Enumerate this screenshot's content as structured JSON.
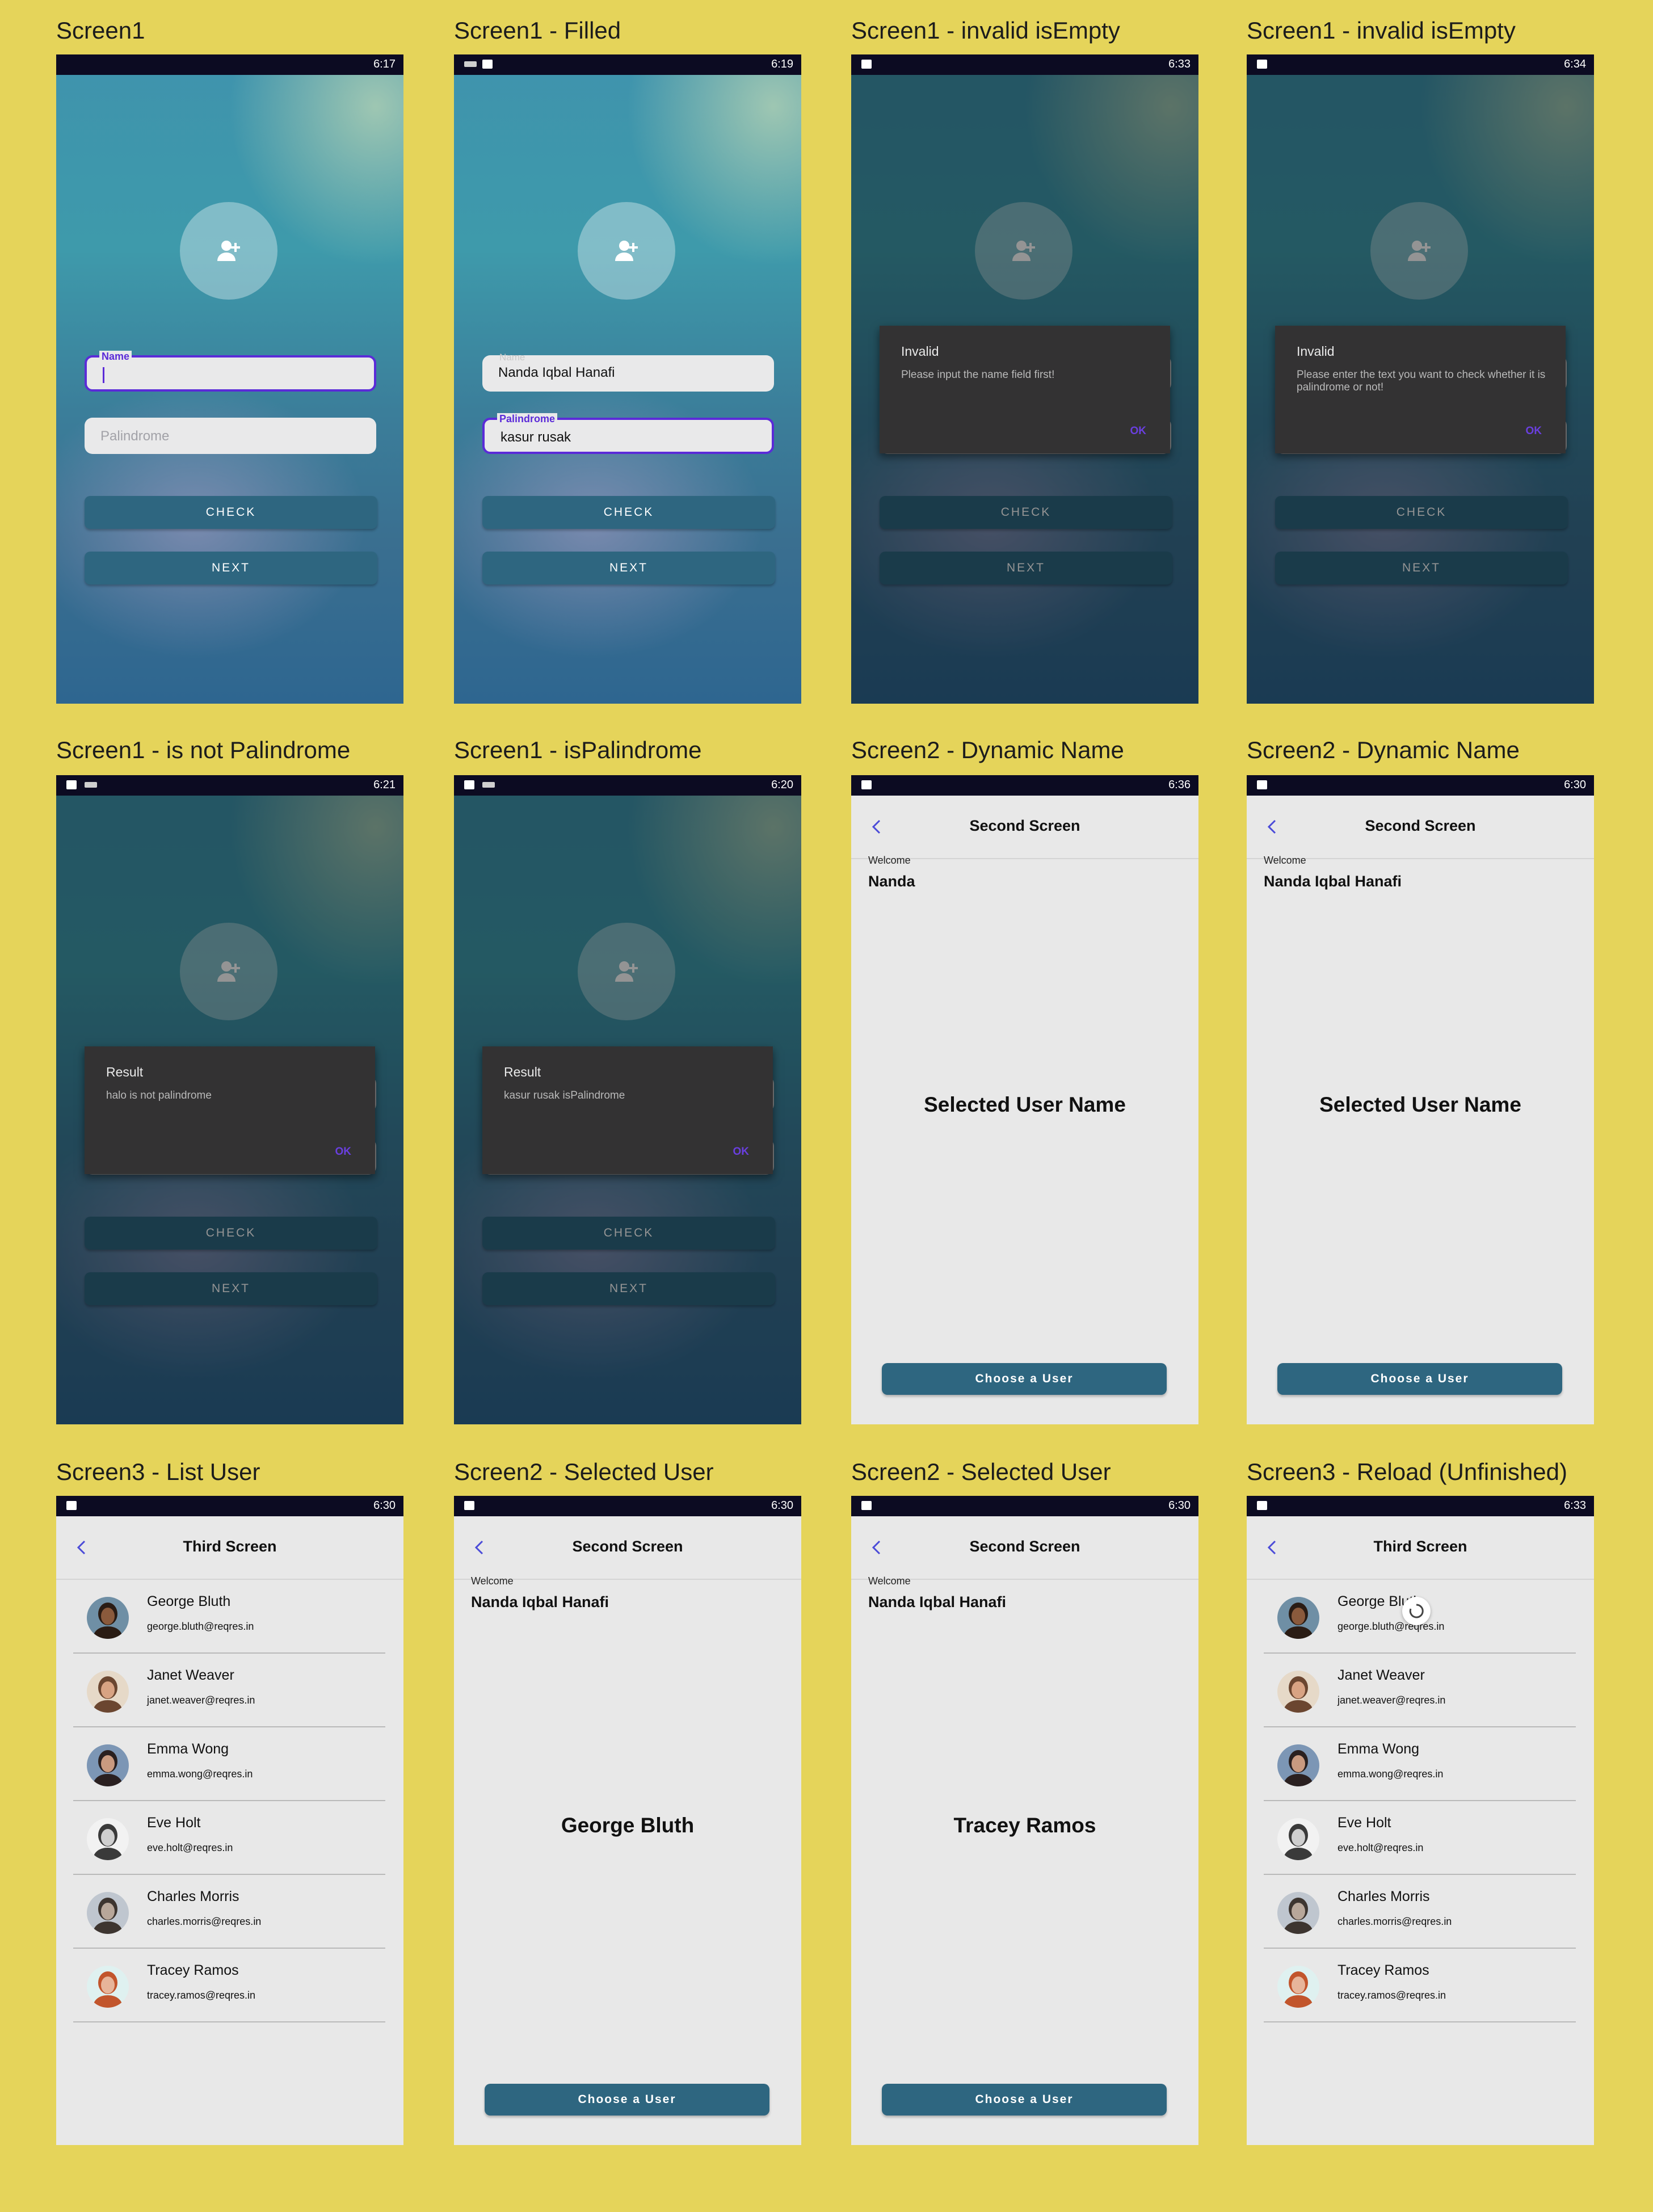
{
  "frames": [
    {
      "title": "Screen1",
      "type": "s1",
      "time": "6:17",
      "icons": [],
      "dim": false,
      "name_label": "Name",
      "name_value": "",
      "name_focus": true,
      "pal_label": "",
      "pal_placeholder": "Palindrome",
      "pal_value": "",
      "pal_focus": false,
      "check": "CHECK",
      "next": "NEXT"
    },
    {
      "title": "Screen1 - Filled",
      "type": "s1",
      "time": "6:19",
      "icons": [
        "kb",
        "img"
      ],
      "dim": false,
      "name_label": "Name",
      "name_value": "Nanda Iqbal Hanafi",
      "name_focus": false,
      "pal_label": "Palindrome",
      "pal_placeholder": "",
      "pal_value": "kasur rusak",
      "pal_focus": true,
      "check": "CHECK",
      "next": "NEXT"
    },
    {
      "title": "Screen1 - invalid isEmpty",
      "type": "s1",
      "time": "6:33",
      "icons": [
        "img"
      ],
      "dim": true,
      "check": "CHECK",
      "next": "NEXT",
      "dialog": {
        "title": "Invalid",
        "message": "Please input the name field first!",
        "ok": "OK"
      }
    },
    {
      "title": "Screen1 - invalid isEmpty",
      "type": "s1",
      "time": "6:34",
      "icons": [
        "img"
      ],
      "dim": true,
      "check": "CHECK",
      "next": "NEXT",
      "dialog": {
        "title": "Invalid",
        "message": "Please enter the text you want to check whether it is palindrome or not!",
        "ok": "OK"
      }
    },
    {
      "title": "Screen1 - is not Palindrome",
      "type": "s1",
      "time": "6:21",
      "icons": [
        "img",
        "kb"
      ],
      "dim": true,
      "check": "CHECK",
      "next": "NEXT",
      "dialog": {
        "title": "Result",
        "message": "halo is not palindrome",
        "ok": "OK"
      }
    },
    {
      "title": "Screen1 - isPalindrome",
      "type": "s1",
      "time": "6:20",
      "icons": [
        "img",
        "kb"
      ],
      "dim": true,
      "check": "CHECK",
      "next": "NEXT",
      "dialog": {
        "title": "Result",
        "message": "kasur rusak isPalindrome",
        "ok": "OK"
      }
    },
    {
      "title": "Screen2 - Dynamic Name",
      "type": "s2",
      "time": "6:36",
      "icons": [
        "img"
      ],
      "appbar_title": "Second Screen",
      "welcome": "Welcome",
      "name": "Nanda",
      "selected": "Selected User Name",
      "choose": "Choose a User"
    },
    {
      "title": "Screen2 - Dynamic Name",
      "type": "s2",
      "time": "6:30",
      "icons": [
        "img"
      ],
      "appbar_title": "Second Screen",
      "welcome": "Welcome",
      "name": "Nanda Iqbal Hanafi",
      "selected": "Selected User Name",
      "choose": "Choose a User"
    },
    {
      "title": "Screen3 - List User",
      "type": "s3",
      "time": "6:30",
      "icons": [
        "img"
      ],
      "appbar_title": "Third Screen",
      "loading": false
    },
    {
      "title": "Screen2 - Selected User",
      "type": "s2",
      "time": "6:30",
      "icons": [
        "img"
      ],
      "appbar_title": "Second Screen",
      "welcome": "Welcome",
      "name": "Nanda Iqbal Hanafi",
      "selected": "George Bluth",
      "choose": "Choose a User"
    },
    {
      "title": "Screen2 - Selected User",
      "type": "s2",
      "time": "6:30",
      "icons": [
        "img"
      ],
      "appbar_title": "Second Screen",
      "welcome": "Welcome",
      "name": "Nanda Iqbal Hanafi",
      "selected": "Tracey Ramos",
      "choose": "Choose a User"
    },
    {
      "title": "Screen3 - Reload (Unfinished)",
      "type": "s3",
      "time": "6:33",
      "icons": [
        "img"
      ],
      "appbar_title": "Third Screen",
      "loading": true
    }
  ],
  "users": [
    {
      "name": "George Bluth",
      "email": "george.bluth@reqres.in",
      "skin": "#8a5a3c",
      "hair": "#2a1c14",
      "bg": "#6f8fa5"
    },
    {
      "name": "Janet Weaver",
      "email": "janet.weaver@reqres.in",
      "skin": "#d8a383",
      "hair": "#6b4630",
      "bg": "#e6d9c8"
    },
    {
      "name": "Emma Wong",
      "email": "emma.wong@reqres.in",
      "skin": "#c99a80",
      "hair": "#2a2020",
      "bg": "#7c96b5"
    },
    {
      "name": "Eve Holt",
      "email": "eve.holt@reqres.in",
      "skin": "#cfcfcf",
      "hair": "#3a3a3a",
      "bg": "#f2f2f2"
    },
    {
      "name": "Charles Morris",
      "email": "charles.morris@reqres.in",
      "skin": "#b8a79a",
      "hair": "#3d3530",
      "bg": "#bfc6cf"
    },
    {
      "name": "Tracey Ramos",
      "email": "tracey.ramos@reqres.in",
      "skin": "#e7b59a",
      "hair": "#c2552c",
      "bg": "#dff1f0"
    }
  ],
  "colors": {
    "page_bg": "#e5d45a",
    "accent": "#5b2bd8",
    "button": "#2e6680",
    "status_bar": "#0c0b22"
  }
}
